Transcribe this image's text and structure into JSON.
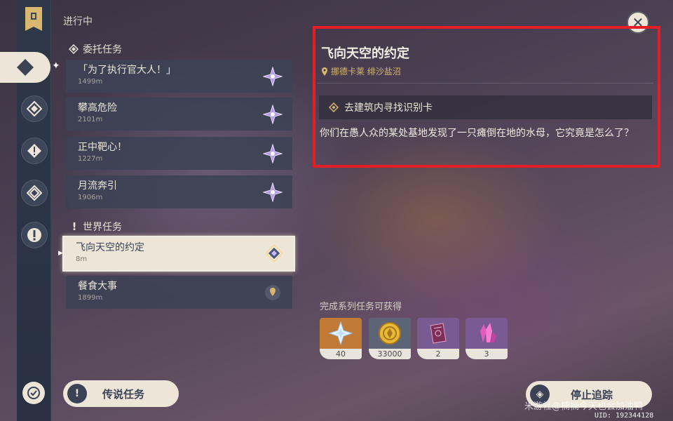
{
  "header": {
    "in_progress": "进行中"
  },
  "sections": {
    "commission": "委托任务",
    "world": "世界任务"
  },
  "commission_quests": [
    {
      "title": "「为了执行官大人！」",
      "distance": "1499m",
      "icon": "commission-star-icon"
    },
    {
      "title": "攀高危险",
      "distance": "2101m",
      "icon": "commission-star-icon"
    },
    {
      "title": "正中靶心！",
      "distance": "1227m",
      "icon": "commission-star-icon"
    },
    {
      "title": "月流奔引",
      "distance": "1906m",
      "icon": "commission-star-icon"
    }
  ],
  "world_quests": [
    {
      "title": "飞向天空的约定",
      "distance": "8m",
      "icon": "tracking-diamond-icon",
      "selected": true
    },
    {
      "title": "餐食大事",
      "distance": "1899m",
      "icon": "location-pin-icon"
    }
  ],
  "detail": {
    "title": "飞向天空的约定",
    "location": "挪德卡莱  绯沙盐沼",
    "objective": "去建筑内寻找识别卡",
    "description": "你们在愚人众的某处基地发现了一只瘫倒在地的水母，它究竟是怎么了？",
    "rewards_title": "完成系列任务可获得",
    "rewards": [
      {
        "name": "primogem-icon",
        "count": "40",
        "bg": "#c07a35"
      },
      {
        "name": "mora-icon",
        "count": "33000",
        "bg": "#5d6476"
      },
      {
        "name": "book-icon",
        "count": "2",
        "bg": "#7a5a93"
      },
      {
        "name": "crystal-icon",
        "count": "3",
        "bg": "#7a5a93"
      }
    ]
  },
  "buttons": {
    "legend": "传说任务",
    "stop_tracking": "停止追踪"
  },
  "footer": {
    "watermark": "米游社@楠楠今天也会加油鸭",
    "uid": "UID: 192344128"
  },
  "colors": {
    "highlight_box": "#e41e26",
    "accent_gold": "#d8b870",
    "panel_light": "#ece5d8"
  }
}
